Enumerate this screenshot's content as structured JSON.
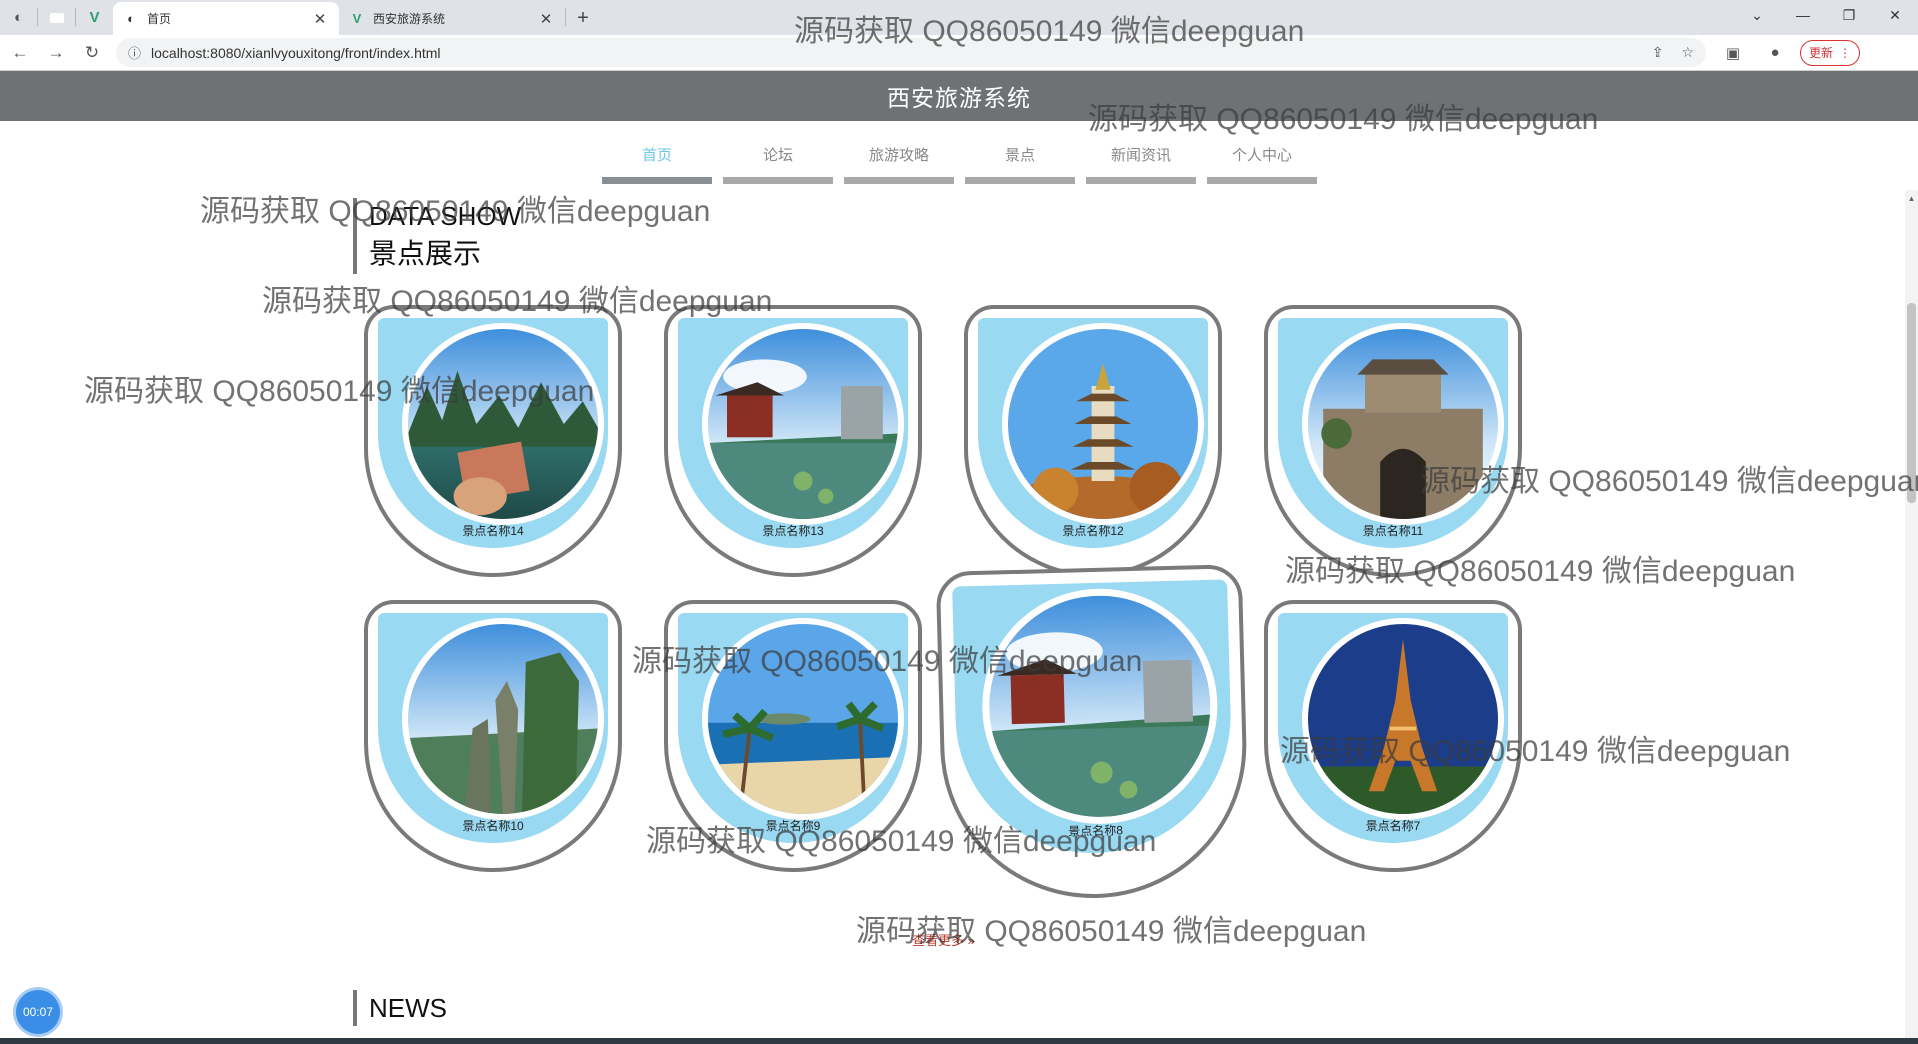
{
  "browser": {
    "tabs": [
      {
        "title": "首页",
        "icon": "globe-icon",
        "active": true
      },
      {
        "title": "西安旅游系统",
        "icon": "vue-logo-icon",
        "active": false
      }
    ],
    "url": "localhost:8080/xianlvyouxitong/front/index.html",
    "update_label": "更新"
  },
  "site": {
    "title": "西安旅游系统"
  },
  "nav": [
    "首页",
    "论坛",
    "旅游攻略",
    "景点",
    "新闻资讯",
    "个人中心"
  ],
  "sections": {
    "data_show": {
      "en": "DATA SHOW",
      "cn": "景点展示"
    },
    "news": {
      "en": "NEWS"
    }
  },
  "cards": [
    {
      "name": "景点名称14",
      "scene": "karst-river"
    },
    {
      "name": "景点名称13",
      "scene": "pavilion-pond"
    },
    {
      "name": "景点名称12",
      "scene": "pagoda"
    },
    {
      "name": "景点名称11",
      "scene": "city-gate"
    },
    {
      "name": "景点名称10",
      "scene": "cliffs"
    },
    {
      "name": "景点名称9",
      "scene": "beach"
    },
    {
      "name": "景点名称8",
      "scene": "pavilion-pond"
    },
    {
      "name": "景点名称7",
      "scene": "eiffel-tower"
    }
  ],
  "more_label": "查看更多 »",
  "timer": "00:07",
  "watermark_text": "源码获取 QQ86050149 微信deepguan"
}
